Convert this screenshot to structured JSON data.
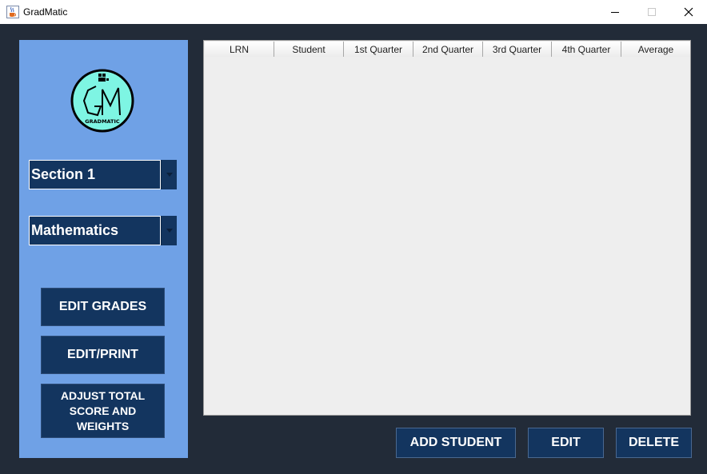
{
  "window": {
    "title": "GradMatic"
  },
  "sidebar": {
    "logo_text": "GRADMATIC",
    "section_combo": {
      "selected": "Section 1"
    },
    "subject_combo": {
      "selected": "Mathematics"
    },
    "buttons": {
      "edit_grades": "EDIT GRADES",
      "edit_print": "EDIT/PRINT",
      "adjust_line1": "ADJUST TOTAL",
      "adjust_line2": "SCORE AND",
      "adjust_line3": "WEIGHTS"
    }
  },
  "table": {
    "columns": [
      "LRN",
      "Student",
      "1st Quarter",
      "2nd Quarter",
      "3rd Quarter",
      "4th Quarter",
      "Average"
    ],
    "rows": []
  },
  "actions": {
    "add_student": "ADD STUDENT",
    "edit": "EDIT",
    "delete": "DELETE"
  },
  "colors": {
    "window_bg": "#222b38",
    "sidebar_bg": "#6fa1e6",
    "button_bg": "#13355f",
    "logo_bg": "#7ef5e3"
  },
  "icons": {
    "app": "java-cup-icon",
    "minimize": "minimize-icon",
    "maximize": "maximize-icon",
    "close": "close-icon",
    "combo_arrow": "chevron-down-icon"
  }
}
